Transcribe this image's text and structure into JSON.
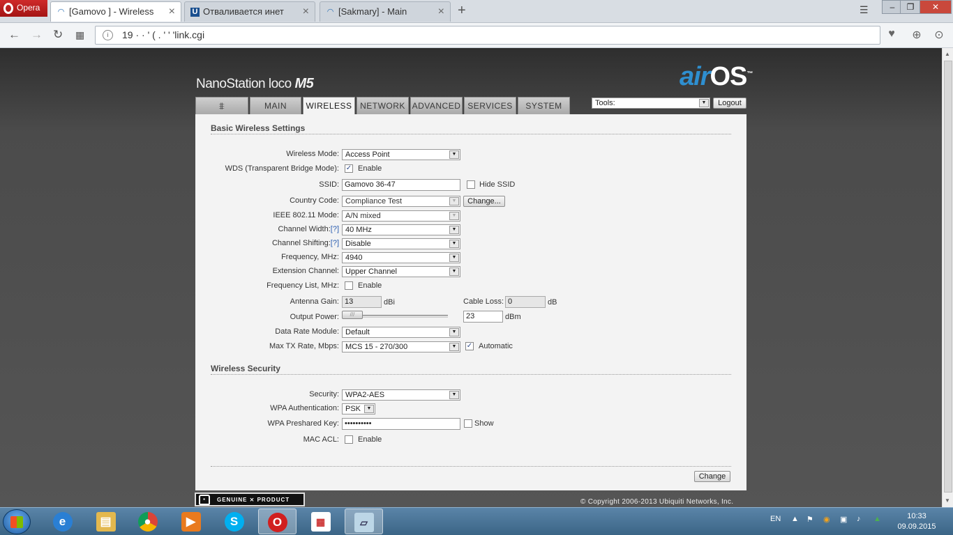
{
  "browser": {
    "menu_label": "Opera",
    "tabs": [
      {
        "title": "[Gamovo ] - Wireless",
        "active": true
      },
      {
        "title": "Отваливается инет",
        "active": false
      },
      {
        "title": "[Sakmary] - Main",
        "active": false
      }
    ],
    "url": "19  ·  · ' (  .  ' ' 'link.cgi"
  },
  "device": {
    "brand": "NanoStation",
    "brand_model": "loco",
    "brand_suffix": "M5",
    "airos_air": "air",
    "airos_os": "OS",
    "airos_tm": "™"
  },
  "nav": {
    "tabs": [
      "MAIN",
      "WIRELESS",
      "NETWORK",
      "ADVANCED",
      "SERVICES",
      "SYSTEM"
    ],
    "active": "WIRELESS",
    "tools_label": "Tools:",
    "logout_label": "Logout"
  },
  "basic": {
    "title": "Basic Wireless Settings",
    "wireless_mode_label": "Wireless Mode:",
    "wireless_mode": "Access Point",
    "wds_label": "WDS (Transparent Bridge Mode):",
    "wds_enable": "Enable",
    "ssid_label": "SSID:",
    "ssid": "Gamovo 36-47",
    "hide_ssid": "Hide SSID",
    "country_label": "Country Code:",
    "country": "Compliance Test",
    "change_label": "Change...",
    "ieee_label": "IEEE 802.11 Mode:",
    "ieee": "A/N mixed",
    "channel_width_label": "Channel Width:",
    "channel_width": "40 MHz",
    "channel_shift_label": "Channel Shifting:",
    "channel_shift": "Disable",
    "help": "[?]",
    "freq_label": "Frequency, MHz:",
    "freq": "4940",
    "ext_label": "Extension Channel:",
    "ext": "Upper Channel",
    "freq_list_label": "Frequency List, MHz:",
    "freq_list_enable": "Enable",
    "gain_label": "Antenna Gain:",
    "gain": "13",
    "gain_unit": "dBi",
    "cable_label": "Cable Loss:",
    "cable": "0",
    "cable_unit": "dB",
    "power_label": "Output Power:",
    "power": "23",
    "power_unit": "dBm",
    "rate_module_label": "Data Rate Module:",
    "rate_module": "Default",
    "tx_rate_label": "Max TX Rate, Mbps:",
    "tx_rate": "MCS 15 - 270/300",
    "automatic": "Automatic"
  },
  "security": {
    "title": "Wireless Security",
    "security_label": "Security:",
    "security": "WPA2-AES",
    "wpa_auth_label": "WPA Authentication:",
    "wpa_auth": "PSK",
    "key_label": "WPA Preshared Key:",
    "key": "••••••••••",
    "show": "Show",
    "mac_label": "MAC ACL:",
    "mac_enable": "Enable"
  },
  "footer": {
    "change_label": "Change",
    "genuine": "GENUINE ⨯ PRODUCT",
    "copyright": "© Copyright 2006-2013 Ubiquiti Networks, Inc."
  },
  "taskbar": {
    "lang": "EN",
    "time": "10:33",
    "date": "09.09.2015"
  }
}
